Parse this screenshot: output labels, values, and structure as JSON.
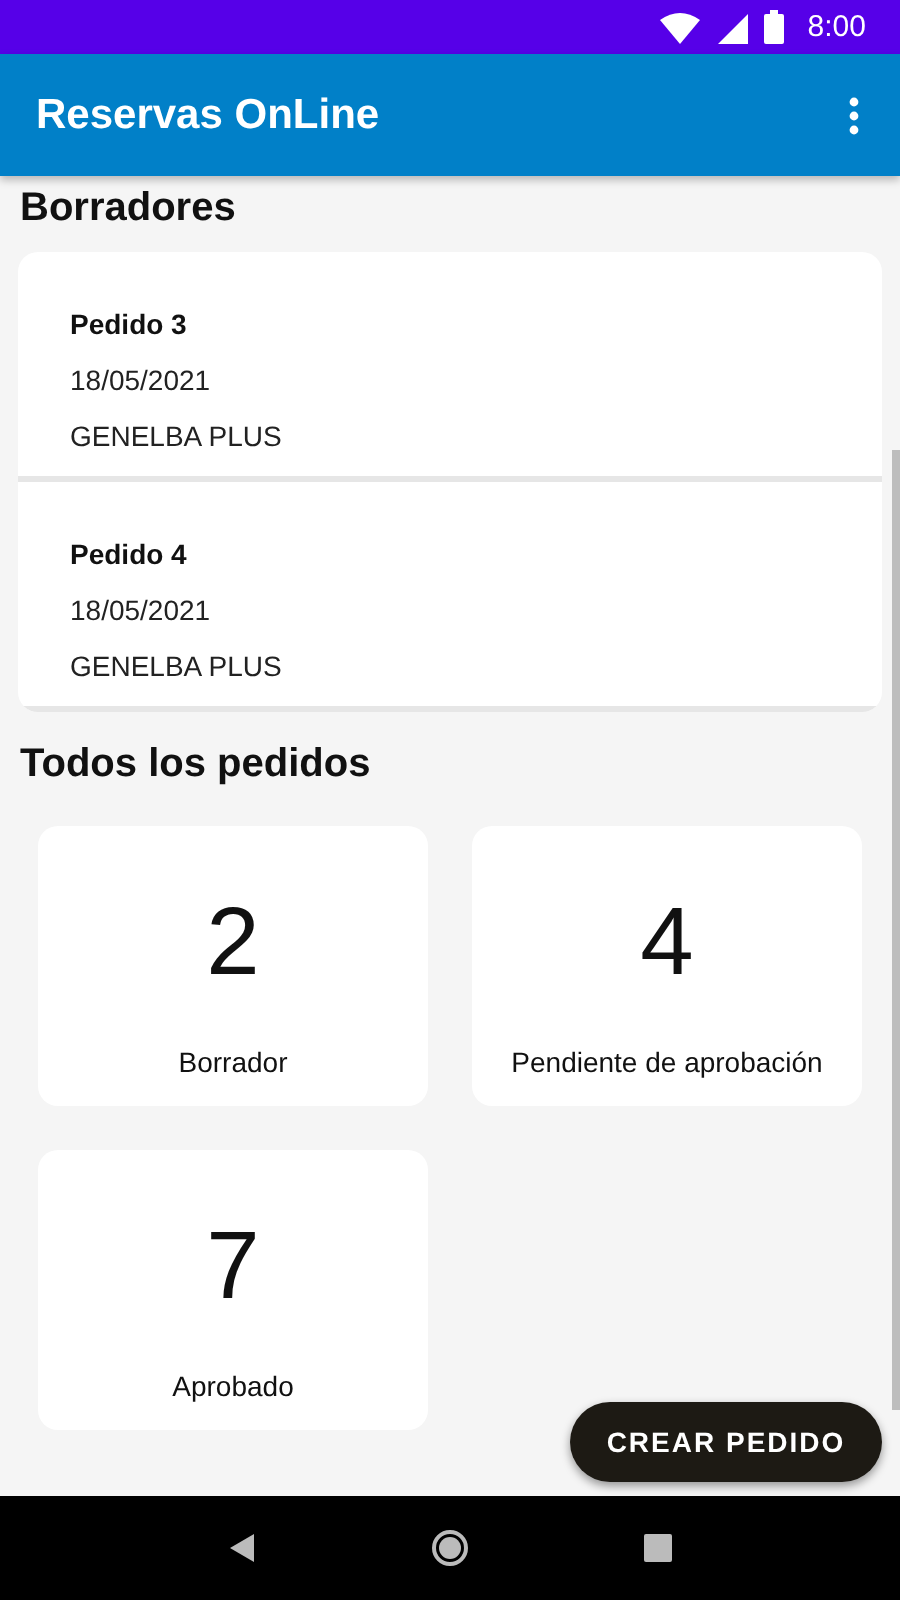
{
  "status_bar": {
    "time": "8:00"
  },
  "app_bar": {
    "title": "Reservas OnLine"
  },
  "drafts": {
    "heading": "Borradores",
    "items": [
      {
        "title": "Pedido 3",
        "date": "18/05/2021",
        "client": "GENELBA PLUS"
      },
      {
        "title": "Pedido 4",
        "date": "18/05/2021",
        "client": "GENELBA PLUS"
      }
    ]
  },
  "all_orders": {
    "heading": "Todos los pedidos",
    "stats": [
      {
        "count": "2",
        "label": "Borrador"
      },
      {
        "count": "4",
        "label": "Pendiente de aprobación"
      },
      {
        "count": "7",
        "label": "Aprobado"
      }
    ]
  },
  "fab": {
    "label": "CREAR PEDIDO"
  }
}
